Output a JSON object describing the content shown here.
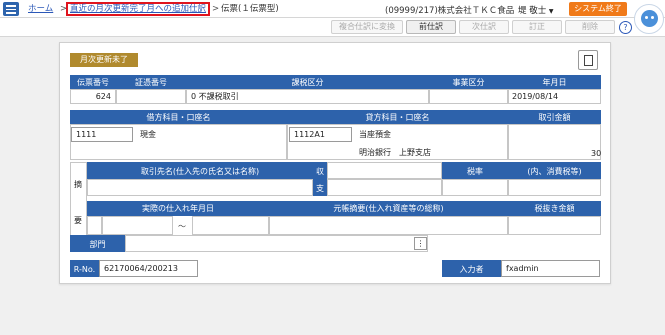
{
  "breadcrumb": {
    "home": "ホーム",
    "sep": ">",
    "current_link": "直近の月次更新完了月への追加仕訳",
    "page": "伝票(１伝票型)"
  },
  "header": {
    "company": "(09999/217)株式会社ＴＫＣ食品",
    "user": "堤 敬士",
    "system_end": "システム終了"
  },
  "toolbar": {
    "multi_copy": "複合仕訳に変換",
    "prev": "前仕訳",
    "next": "次仕訳",
    "correct": "訂正",
    "delete": "削除",
    "help": "?"
  },
  "form": {
    "status_badge": "月次更新未了",
    "headers": {
      "slip_no": "伝票番号",
      "voucher_no": "証憑番号",
      "tax_class": "課税区分",
      "business_class": "事業区分",
      "date": "年月日",
      "debit_account": "借方科目・口座名",
      "credit_account": "貸方科目・口座名",
      "amount": "取引金額",
      "counterparty": "取引先名(仕入先の氏名又は名称)",
      "receipt_1": "収",
      "receipt_2": "支",
      "tax_rate": "税率",
      "consumption_tax": "(内、消費税等)",
      "tekiyo_1": "摘",
      "tekiyo_2": "要",
      "purchase_date": "実際の仕入れ年月日",
      "ledger_summary": "元帳摘要(仕入れ資産等の総称)",
      "net_amount": "税抜き金額",
      "department": "部門",
      "r_no": "R-No.",
      "input_by": "入力者"
    },
    "values": {
      "slip_no": "624",
      "tax_class": "0 不課税取引",
      "date": "2019/08/14",
      "debit_code": "1111",
      "debit_name": "現金",
      "credit_code": "1112A1",
      "credit_name": "当座預金",
      "credit_sub": "明治銀行　上野支店",
      "amount": "30",
      "tilde": "～",
      "r_no": "62170064/200213",
      "input_by": "fxadmin",
      "menu_dots": "⋮"
    }
  }
}
